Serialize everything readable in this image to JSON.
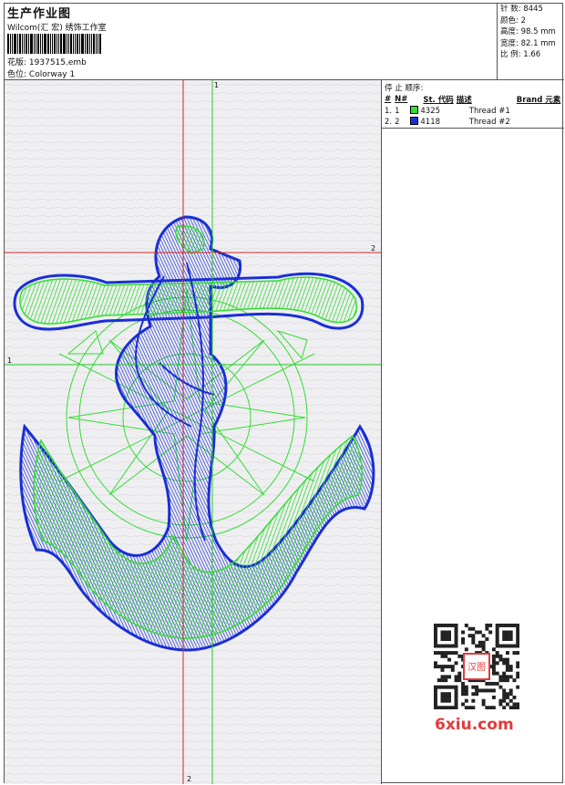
{
  "header": {
    "title": "生产作业图",
    "studio": "Wilcom(汇 宏) 绣饰工作室",
    "design_label": "花版:",
    "design_value": "1937515.emb",
    "colorway_label": "色位:",
    "colorway_value": "Colorway 1"
  },
  "specs": [
    {
      "label": "针 数:",
      "value": "8445"
    },
    {
      "label": "颜色:",
      "value": "2"
    },
    {
      "label": "高度:",
      "value": "98.5 mm"
    },
    {
      "label": "宽度:",
      "value": "82.1 mm"
    },
    {
      "label": "比 例:",
      "value": "1.66"
    }
  ],
  "stop_sequence": {
    "heading": "停 止 顺序:",
    "columns": [
      "#",
      "N#",
      "St.",
      "代码",
      "描述",
      "Brand",
      "元素"
    ],
    "rows": [
      {
        "index": "1.",
        "needle": "1",
        "code": "4325",
        "description": "Thread #1",
        "color": "#33dd33"
      },
      {
        "index": "2.",
        "needle": "2",
        "code": "4118",
        "description": "Thread #2",
        "color": "#1a2fd6"
      }
    ]
  },
  "axes": {
    "vertical_green": "1",
    "horizontal_green": "1",
    "vertical_red": "2",
    "horizontal_red": "2"
  },
  "colors": {
    "thread1": "#33dd33",
    "thread2": "#1a2fd6",
    "axis_red": "#dd2222",
    "axis_green": "#22cc22"
  },
  "watermark": {
    "text": "6xiu.com",
    "stamp": "汉图"
  }
}
